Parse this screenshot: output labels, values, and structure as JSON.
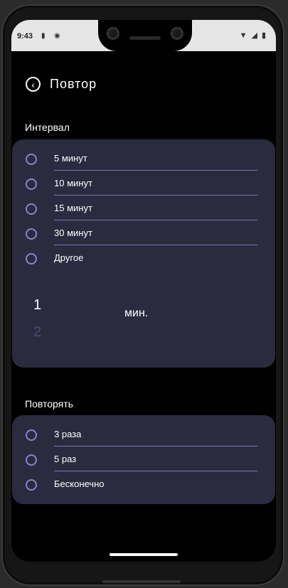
{
  "status": {
    "time": "9:43"
  },
  "header": {
    "title": "Повтор"
  },
  "interval": {
    "label": "Интервал",
    "options": [
      "5 минут",
      "10 минут",
      "15 минут",
      "30 минут",
      "Другое"
    ],
    "picker": {
      "current": "1",
      "next": "2",
      "unit": "мин."
    }
  },
  "repeat": {
    "label": "Повторять",
    "options": [
      "3 раза",
      "5 раз",
      "Бесконечно"
    ]
  },
  "colors": {
    "card": "#2b2b3f",
    "accent": "#8b82c9",
    "background": "#000000"
  },
  "icons": {
    "back": "arrow-left-circle-icon"
  }
}
